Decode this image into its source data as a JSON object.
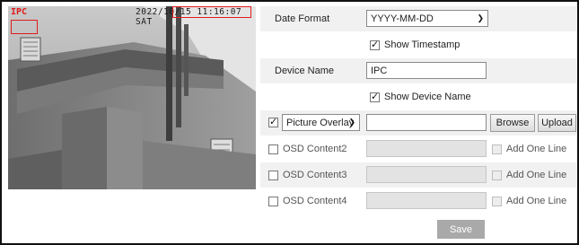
{
  "preview": {
    "osd_name": "IPC",
    "osd_time": "2022/10/15 11:16:07 SAT"
  },
  "date_format": {
    "label": "Date Format",
    "value": "YYYY-MM-DD"
  },
  "show_timestamp": {
    "label": "Show Timestamp",
    "checked": true
  },
  "device_name": {
    "label": "Device Name",
    "value": "IPC"
  },
  "show_device_name": {
    "label": "Show Device Name",
    "checked": true
  },
  "overlay": {
    "checked": true,
    "type_value": "Picture Overlay",
    "path_value": "",
    "browse_label": "Browse",
    "upload_label": "Upload"
  },
  "osd_rows": [
    {
      "label": "OSD Content2",
      "add_label": "Add One Line"
    },
    {
      "label": "OSD Content3",
      "add_label": "Add One Line"
    },
    {
      "label": "OSD Content4",
      "add_label": "Add One Line"
    }
  ],
  "save_label": "Save",
  "icons": {
    "dropdown": "chevron-down-icon",
    "check": "checkmark-icon"
  }
}
